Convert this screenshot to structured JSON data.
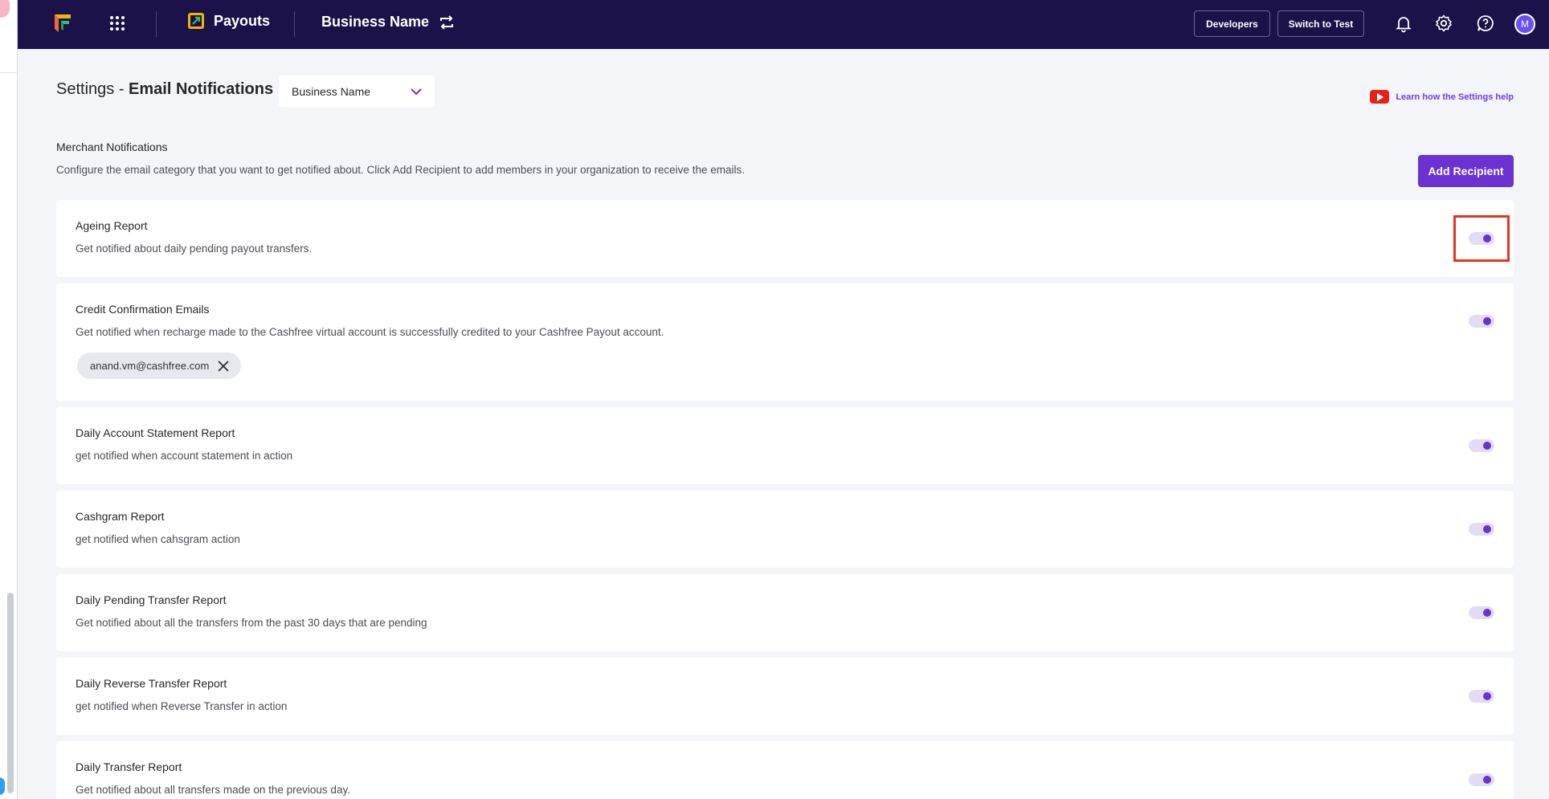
{
  "header": {
    "product": "Payouts",
    "business_name": "Business Name",
    "developers_label": "Developers",
    "switch_label": "Switch to Test",
    "avatar_initial": "M"
  },
  "page": {
    "title_prefix": "Settings - ",
    "title_main": "Email Notifications",
    "business_select": "Business Name",
    "learn_link": "Learn how the Settings help"
  },
  "section": {
    "title": "Merchant Notifications",
    "description": "Configure the email category that you want to get notified about. Click Add Recipient to add members in your organization to receive the emails.",
    "add_recipient": "Add Recipient"
  },
  "notifications": [
    {
      "title": "Ageing Report",
      "description": "Get notified about daily pending payout transfers.",
      "enabled": true
    },
    {
      "title": "Credit Confirmation Emails",
      "description": "Get notified when recharge made to the Cashfree virtual account is successfully credited to your Cashfree Payout account.",
      "enabled": true,
      "recipient": "anand.vm@cashfree.com"
    },
    {
      "title": "Daily Account Statement Report",
      "description": "get notified when account statement in action",
      "enabled": true
    },
    {
      "title": "Cashgram Report",
      "description": "get notified when cahsgram action",
      "enabled": true
    },
    {
      "title": "Daily Pending Transfer Report",
      "description": "Get notified about all the transfers from the past 30 days that are pending",
      "enabled": true
    },
    {
      "title": "Daily Reverse Transfer Report",
      "description": "get notified when Reverse Transfer in action",
      "enabled": true
    },
    {
      "title": "Daily Transfer Report",
      "description": "Get notified about all transfers made on the previous day.",
      "enabled": true
    }
  ],
  "colors": {
    "topbar": "#1b124a",
    "accent": "#6a32d1",
    "highlight": "#e8321f"
  }
}
